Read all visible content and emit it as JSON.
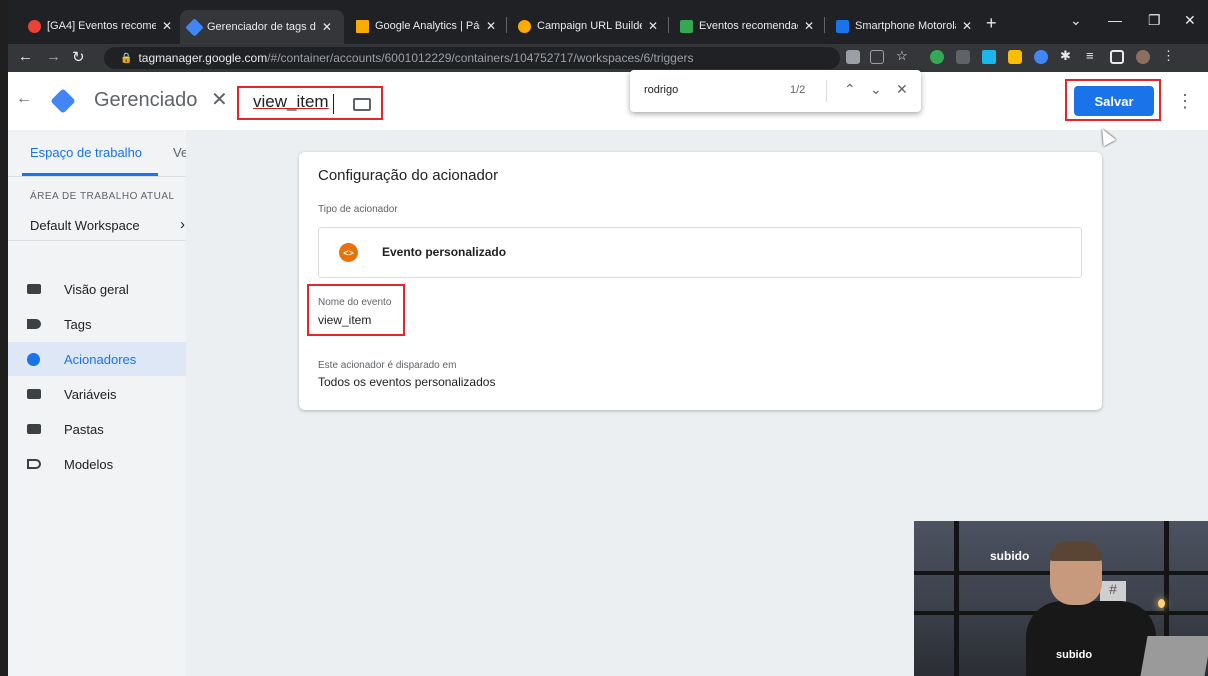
{
  "browser": {
    "tabs": [
      {
        "title": "[GA4] Eventos recome",
        "color": "#ea4335",
        "active": false
      },
      {
        "title": "Gerenciador de tags d",
        "color": "#4285f4",
        "active": true
      },
      {
        "title": "Google Analytics | Pág",
        "color": "#f9ab00",
        "active": false
      },
      {
        "title": "Campaign URL Builde",
        "color": "#f9ab00",
        "active": false
      },
      {
        "title": "Eventos recomendado",
        "color": "#34a853",
        "active": false
      },
      {
        "title": "Smartphone Motorola",
        "color": "#1a73e8",
        "active": false
      }
    ],
    "url_domain": "tagmanager.google.com",
    "url_path": "/#/container/accounts/6001012229/containers/104752717/workspaces/6/triggers"
  },
  "find_bar": {
    "query": "rodrigo",
    "count": "1/2"
  },
  "header": {
    "app_title": "Gerenciado",
    "trigger_name": "view_item",
    "save_label": "Salvar"
  },
  "sidebar": {
    "tab_workspace": "Espaço de trabalho",
    "tab_versions": "Ve",
    "workspace_section_label": "ÁREA DE TRABALHO ATUAL",
    "workspace_name": "Default Workspace",
    "items": [
      {
        "label": "Visão geral"
      },
      {
        "label": "Tags"
      },
      {
        "label": "Acionadores"
      },
      {
        "label": "Variáveis"
      },
      {
        "label": "Pastas"
      },
      {
        "label": "Modelos"
      }
    ]
  },
  "trigger_config": {
    "title": "Configuração do acionador",
    "type_label": "Tipo de acionador",
    "type_name": "Evento personalizado",
    "event_name_label": "Nome do evento",
    "event_name_value": "view_item",
    "fires_on_label": "Este acionador é disparado em",
    "fires_on_value": "Todos os eventos personalizados"
  },
  "webcam": {
    "sign_text": "subido",
    "shirt_text": "subido",
    "hash_text": "#"
  },
  "colors": {
    "accent": "#1a73e8",
    "highlight": "#e3262b",
    "trigger_icon": "#e8710a"
  }
}
